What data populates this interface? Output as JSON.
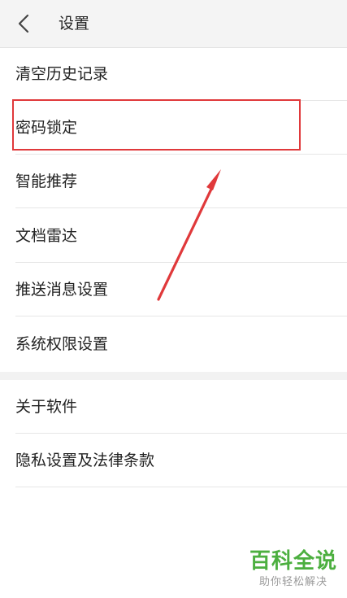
{
  "header": {
    "title": "设置",
    "back_icon": "chevron-left-icon"
  },
  "menu": {
    "group1": [
      {
        "label": "清空历史记录"
      },
      {
        "label": "密码锁定"
      },
      {
        "label": "智能推荐"
      },
      {
        "label": "文档雷达"
      },
      {
        "label": "推送消息设置"
      },
      {
        "label": "系统权限设置"
      }
    ],
    "group2": [
      {
        "label": "关于软件"
      },
      {
        "label": "隐私设置及法律条款"
      }
    ]
  },
  "annotation": {
    "highlight_color": "#e0393b"
  },
  "watermark": {
    "title": "百科全说",
    "subtitle": "助你轻松解决",
    "color": "#4caf3f"
  }
}
